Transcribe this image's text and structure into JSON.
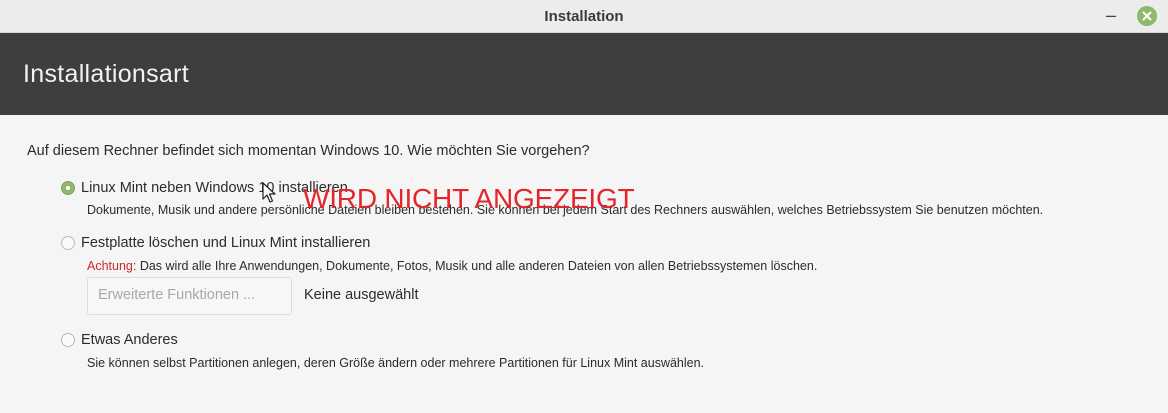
{
  "window": {
    "title": "Installation",
    "minimize_glyph": "–",
    "close_icon": "close-icon"
  },
  "header": {
    "title": "Installationsart",
    "background": "#3e3e3e"
  },
  "main": {
    "question": "Auf diesem Rechner befindet sich momentan Windows 10. Wie möchten Sie vorgehen?",
    "options": [
      {
        "label": "Linux Mint neben Windows 10 installieren",
        "description": "Dokumente, Musik und andere persönliche Dateien bleiben bestehen. Sie können bei jedem Start des Rechners auswählen, welches Betriebssystem Sie benutzen möchten.",
        "selected": true
      },
      {
        "label": "Festplatte löschen und Linux Mint installieren",
        "warning_label": "Achtung:",
        "description": "Das wird alle Ihre Anwendungen, Dokumente, Fotos, Musik und alle anderen Dateien von allen Betriebssystemen löschen.",
        "selected": false,
        "advanced_button": "Erweiterte Funktionen ...",
        "advanced_value": "Keine ausgewählt"
      },
      {
        "label": "Etwas Anderes",
        "description": "Sie können selbst Partitionen anlegen, deren Größe ändern oder mehrere Partitionen für Linux Mint auswählen.",
        "selected": false
      }
    ]
  },
  "overlay": {
    "text": "WIRD NICHT ANGEZEIGT",
    "color": "#e3262b"
  },
  "colors": {
    "accent": "#8fb86a",
    "warning": "#cc2a2a"
  }
}
